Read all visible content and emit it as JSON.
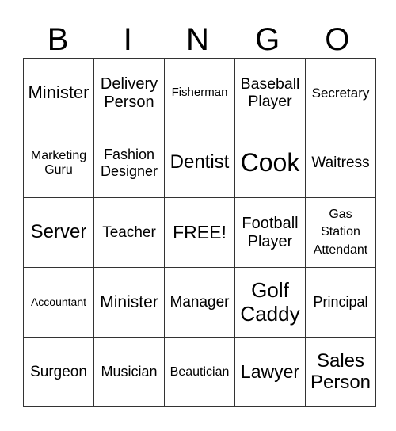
{
  "header": {
    "letters": [
      "B",
      "I",
      "N",
      "G",
      "O"
    ]
  },
  "card": {
    "rows": [
      [
        {
          "text": "Minister",
          "size": "l"
        },
        {
          "text": "Delivery Person",
          "size": "m"
        },
        {
          "text": "Fisherman",
          "size": "xs"
        },
        {
          "text": "Baseball Player",
          "size": "m"
        },
        {
          "text": "Secretary",
          "size": "s"
        }
      ],
      [
        {
          "text": "Marketing Guru",
          "size": "s"
        },
        {
          "text": "Fashion Designer",
          "size": "m"
        },
        {
          "text": "Dentist",
          "size": "l"
        },
        {
          "text": "Cook",
          "size": "xl"
        },
        {
          "text": "Waitress",
          "size": "m"
        }
      ],
      [
        {
          "text": "Server",
          "size": "l"
        },
        {
          "text": "Teacher",
          "size": "m"
        },
        {
          "text": "FREE!",
          "size": "l",
          "free": true
        },
        {
          "text": "Football Player",
          "size": "m"
        },
        {
          "text": "Gas Station Attendant",
          "size": "s"
        }
      ],
      [
        {
          "text": "Accountant",
          "size": "xs"
        },
        {
          "text": "Minister",
          "size": "l"
        },
        {
          "text": "Manager",
          "size": "m"
        },
        {
          "text": "Golf Caddy",
          "size": "l"
        },
        {
          "text": "Principal",
          "size": "m"
        }
      ],
      [
        {
          "text": "Surgeon",
          "size": "m"
        },
        {
          "text": "Musician",
          "size": "m"
        },
        {
          "text": "Beautician",
          "size": "s"
        },
        {
          "text": "Lawyer",
          "size": "l"
        },
        {
          "text": "Sales Person",
          "size": "l"
        }
      ]
    ]
  }
}
